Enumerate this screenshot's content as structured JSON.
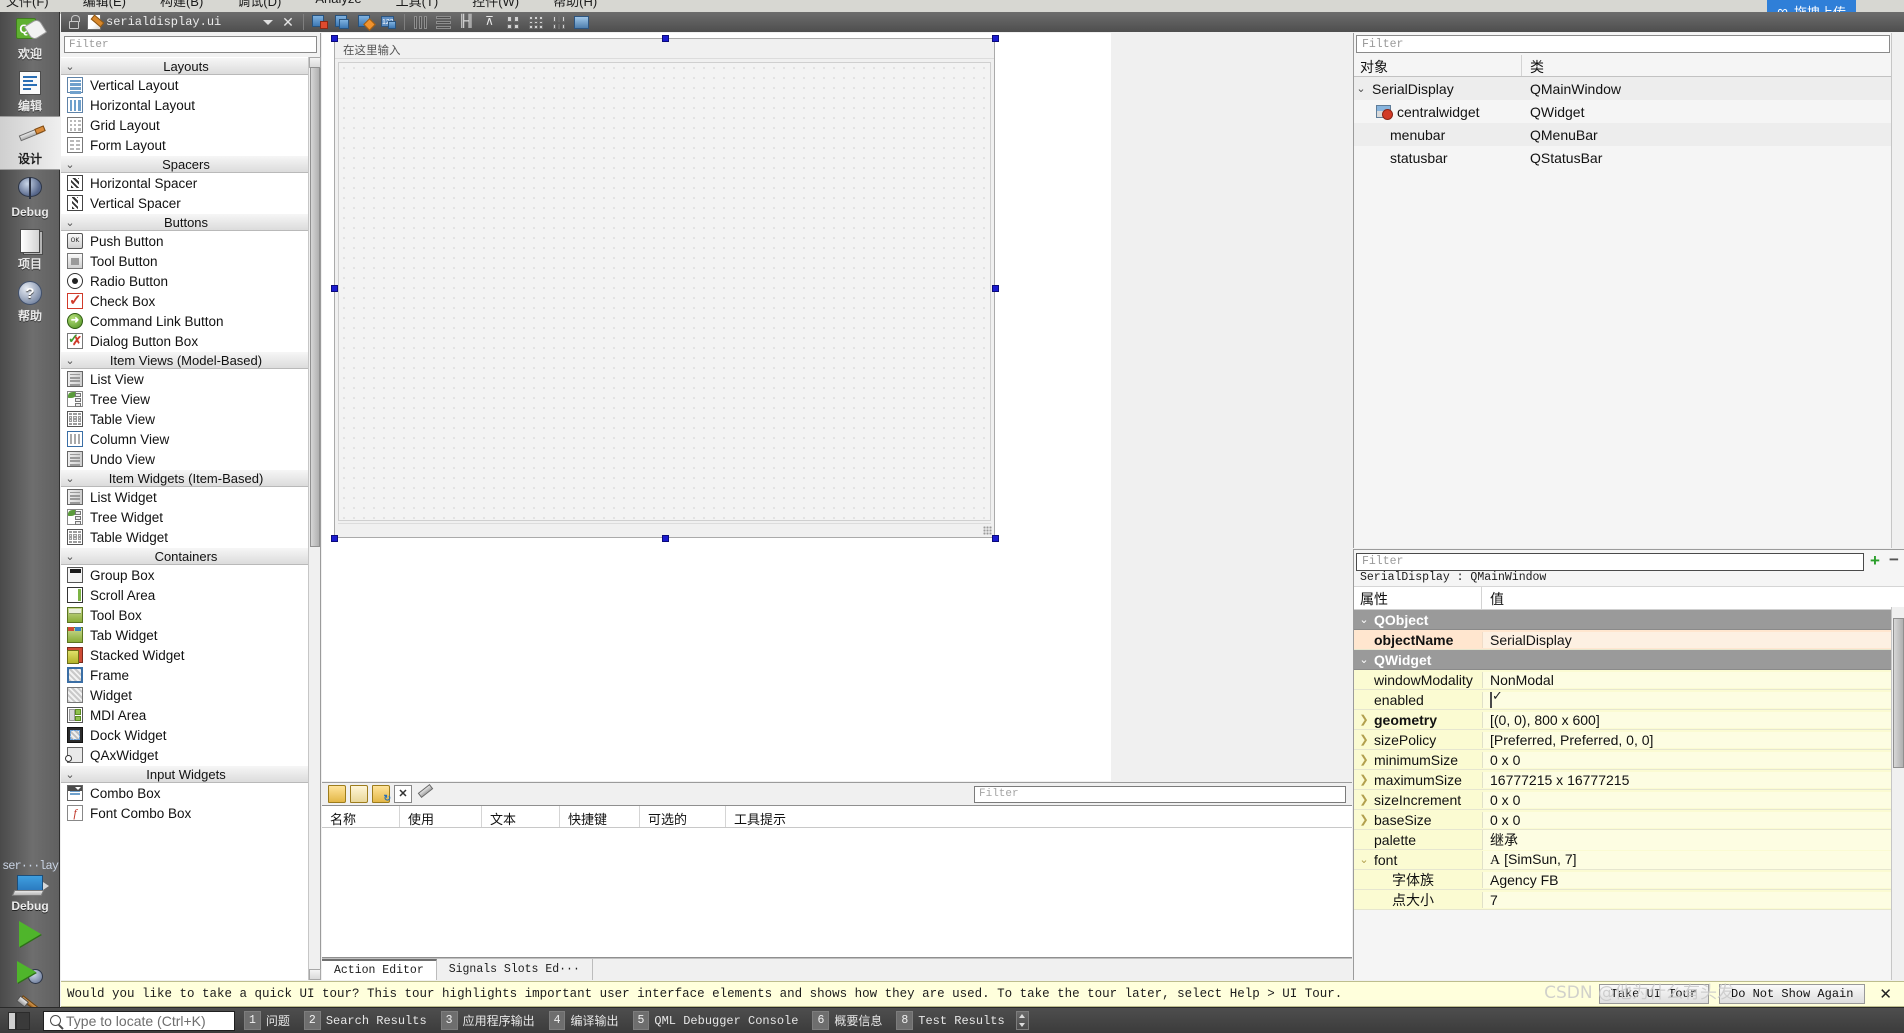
{
  "app": {
    "menu_items": [
      "文件(F)",
      "编辑(E)",
      "构建(B)",
      "调试(D)",
      "Analyze",
      "工具(T)",
      "控件(W)",
      "帮助(H)"
    ],
    "upload_chip": "拖拽上传",
    "watermark": "CSDN @他为什么有头发"
  },
  "designer_toolbar": {
    "lock_icon": "lock-icon",
    "filename": "serialdisplay.ui",
    "dropdown_icon": "chevron-down-icon",
    "close_icon": "close-icon",
    "buttons": [
      {
        "name": "edit-widgets-button",
        "icon": "edit-widgets-icon"
      },
      {
        "name": "edit-signals-slots-button",
        "icon": "signals-slots-icon"
      },
      {
        "name": "edit-buddies-button",
        "icon": "buddies-icon"
      },
      {
        "name": "edit-tab-order-button",
        "icon": "tab-order-icon"
      },
      {
        "name": "layout-horizontally-button",
        "icon": "layout-horizontal-icon"
      },
      {
        "name": "layout-vertically-button",
        "icon": "layout-vertical-icon"
      },
      {
        "name": "layout-splitter-h-button",
        "icon": "splitter-horizontal-icon"
      },
      {
        "name": "layout-splitter-v-button",
        "icon": "splitter-vertical-icon"
      },
      {
        "name": "layout-form-button",
        "icon": "form-layout-icon"
      },
      {
        "name": "layout-grid-button",
        "icon": "grid-layout-icon"
      },
      {
        "name": "break-layout-button",
        "icon": "break-layout-icon"
      },
      {
        "name": "adjust-size-button",
        "icon": "adjust-size-icon"
      }
    ]
  },
  "modebar": {
    "items": [
      {
        "label": "欢迎",
        "icon": "qt-logo-icon",
        "active": false
      },
      {
        "label": "编辑",
        "icon": "edit-mode-icon",
        "active": false
      },
      {
        "label": "设计",
        "icon": "design-mode-icon",
        "active": true
      },
      {
        "label": "Debug",
        "icon": "debug-mode-icon",
        "active": false
      },
      {
        "label": "项目",
        "icon": "projects-mode-icon",
        "active": false
      },
      {
        "label": "帮助",
        "icon": "help-mode-icon",
        "active": false
      }
    ],
    "kit_label": "ser···lay",
    "kit_name": "Debug",
    "run_button": "run-icon",
    "debug_button": "start-debugging-icon",
    "build_button": "build-icon"
  },
  "widget_box": {
    "filter_placeholder": "Filter",
    "groups": [
      {
        "title": "Layouts",
        "expanded": true,
        "items": [
          {
            "label": "Vertical Layout",
            "icon": "vertical-layout-icon"
          },
          {
            "label": "Horizontal Layout",
            "icon": "horizontal-layout-icon"
          },
          {
            "label": "Grid Layout",
            "icon": "grid-layout-icon"
          },
          {
            "label": "Form Layout",
            "icon": "form-layout-icon"
          }
        ]
      },
      {
        "title": "Spacers",
        "expanded": true,
        "items": [
          {
            "label": "Horizontal Spacer",
            "icon": "horizontal-spacer-icon"
          },
          {
            "label": "Vertical Spacer",
            "icon": "vertical-spacer-icon"
          }
        ]
      },
      {
        "title": "Buttons",
        "expanded": true,
        "items": [
          {
            "label": "Push Button",
            "icon": "push-button-icon"
          },
          {
            "label": "Tool Button",
            "icon": "tool-button-icon"
          },
          {
            "label": "Radio Button",
            "icon": "radio-button-icon"
          },
          {
            "label": "Check Box",
            "icon": "check-box-icon"
          },
          {
            "label": "Command Link Button",
            "icon": "command-link-icon"
          },
          {
            "label": "Dialog Button Box",
            "icon": "dialog-button-box-icon"
          }
        ]
      },
      {
        "title": "Item Views (Model-Based)",
        "expanded": true,
        "items": [
          {
            "label": "List View",
            "icon": "list-view-icon"
          },
          {
            "label": "Tree View",
            "icon": "tree-view-icon"
          },
          {
            "label": "Table View",
            "icon": "table-view-icon"
          },
          {
            "label": "Column View",
            "icon": "column-view-icon"
          },
          {
            "label": "Undo View",
            "icon": "undo-view-icon"
          }
        ]
      },
      {
        "title": "Item Widgets (Item-Based)",
        "expanded": true,
        "items": [
          {
            "label": "List Widget",
            "icon": "list-widget-icon"
          },
          {
            "label": "Tree Widget",
            "icon": "tree-widget-icon"
          },
          {
            "label": "Table Widget",
            "icon": "table-widget-icon"
          }
        ]
      },
      {
        "title": "Containers",
        "expanded": true,
        "items": [
          {
            "label": "Group Box",
            "icon": "group-box-icon"
          },
          {
            "label": "Scroll Area",
            "icon": "scroll-area-icon"
          },
          {
            "label": "Tool Box",
            "icon": "tool-box-icon"
          },
          {
            "label": "Tab Widget",
            "icon": "tab-widget-icon"
          },
          {
            "label": "Stacked Widget",
            "icon": "stacked-widget-icon"
          },
          {
            "label": "Frame",
            "icon": "frame-icon"
          },
          {
            "label": "Widget",
            "icon": "widget-icon"
          },
          {
            "label": "MDI Area",
            "icon": "mdi-area-icon"
          },
          {
            "label": "Dock Widget",
            "icon": "dock-widget-icon"
          },
          {
            "label": "QAxWidget",
            "icon": "qax-widget-icon"
          }
        ]
      },
      {
        "title": "Input Widgets",
        "expanded": true,
        "items": [
          {
            "label": "Combo Box",
            "icon": "combo-box-icon"
          },
          {
            "label": "Font Combo Box",
            "icon": "font-combo-box-icon"
          }
        ]
      }
    ]
  },
  "form_editor": {
    "menubar_hint": "在这里输入",
    "window_size": "800 x 600"
  },
  "action_editor": {
    "filter_placeholder": "Filter",
    "columns": [
      "名称",
      "使用",
      "文本",
      "快捷键",
      "可选的",
      "工具提示"
    ],
    "rows": [],
    "tabs": [
      {
        "label": "Action Editor",
        "active": true
      },
      {
        "label": "Signals  Slots Ed···",
        "active": false
      }
    ],
    "toolbar_icons": [
      "new-action-icon",
      "copy-action-icon",
      "paste-action-icon",
      "delete-action-icon",
      "configure-icon"
    ]
  },
  "object_inspector": {
    "filter_placeholder": "Filter",
    "columns": [
      "对象",
      "类"
    ],
    "rows": [
      {
        "name": "SerialDisplay",
        "class": "QMainWindow",
        "indent": 0,
        "expandable": true,
        "icon": null
      },
      {
        "name": "centralwidget",
        "class": "QWidget",
        "indent": 1,
        "expandable": false,
        "icon": "central-widget-icon"
      },
      {
        "name": "menubar",
        "class": "QMenuBar",
        "indent": 1,
        "expandable": false,
        "icon": null
      },
      {
        "name": "statusbar",
        "class": "QStatusBar",
        "indent": 1,
        "expandable": false,
        "icon": null
      }
    ]
  },
  "property_editor": {
    "filter_placeholder": "Filter",
    "subject": "SerialDisplay : QMainWindow",
    "columns": [
      "属性",
      "值"
    ],
    "rows": [
      {
        "kind": "group",
        "key": "QObject",
        "value": "",
        "expanded": true
      },
      {
        "kind": "prop",
        "key": "objectName",
        "value": "SerialDisplay",
        "bold": true,
        "highlight": "orange",
        "expandable": false
      },
      {
        "kind": "group",
        "key": "QWidget",
        "value": "",
        "expanded": true
      },
      {
        "kind": "prop",
        "key": "windowModality",
        "value": "NonModal",
        "bold": false,
        "highlight": "yellow",
        "expandable": false
      },
      {
        "kind": "prop",
        "key": "enabled",
        "value": "",
        "bold": false,
        "highlight": "yellow",
        "expandable": false,
        "control": "checkbox"
      },
      {
        "kind": "prop",
        "key": "geometry",
        "value": "[(0, 0), 800 x 600]",
        "bold": true,
        "highlight": "yellow",
        "expandable": true
      },
      {
        "kind": "prop",
        "key": "sizePolicy",
        "value": "[Preferred, Preferred, 0, 0]",
        "bold": false,
        "highlight": "yellow",
        "expandable": true
      },
      {
        "kind": "prop",
        "key": "minimumSize",
        "value": "0 x 0",
        "bold": false,
        "highlight": "yellow",
        "expandable": true
      },
      {
        "kind": "prop",
        "key": "maximumSize",
        "value": "16777215 x 16777215",
        "bold": false,
        "highlight": "yellow",
        "expandable": true
      },
      {
        "kind": "prop",
        "key": "sizeIncrement",
        "value": "0 x 0",
        "bold": false,
        "highlight": "yellow",
        "expandable": true
      },
      {
        "kind": "prop",
        "key": "baseSize",
        "value": "0 x 0",
        "bold": false,
        "highlight": "yellow",
        "expandable": true
      },
      {
        "kind": "prop",
        "key": "palette",
        "value": "继承",
        "bold": false,
        "highlight": "yellow",
        "expandable": false
      },
      {
        "kind": "prop",
        "key": "font",
        "value": "[SimSun, 7]",
        "bold": false,
        "highlight": "yellow",
        "expanded": true,
        "control": "font"
      },
      {
        "kind": "subprop",
        "key": "字体族",
        "value": "Agency FB",
        "bold": false,
        "highlight": "yellow"
      },
      {
        "kind": "subprop",
        "key": "点大小",
        "value": "7",
        "bold": false,
        "highlight": "yellow"
      }
    ],
    "add_button": "+",
    "remove_button": "−"
  },
  "tour_bar": {
    "message": "Would you like to take a quick UI tour? This tour highlights important user interface elements and shows how they are used. To take the tour later, select Help > UI Tour.",
    "take_tour": "Take UI Tour",
    "dismiss": "Do Not Show Again",
    "close_icon": "close-icon"
  },
  "status_bar": {
    "sidebar_toggle": "toggle-sidebar-icon",
    "locate_placeholder": "Type to locate (Ctrl+K)",
    "search_icon": "search-icon",
    "panes": [
      {
        "num": "1",
        "label": "问题"
      },
      {
        "num": "2",
        "label": "Search Results"
      },
      {
        "num": "3",
        "label": "应用程序输出"
      },
      {
        "num": "4",
        "label": "编译输出"
      },
      {
        "num": "5",
        "label": "QML Debugger Console"
      },
      {
        "num": "6",
        "label": "概要信息"
      },
      {
        "num": "8",
        "label": "Test Results"
      }
    ]
  }
}
